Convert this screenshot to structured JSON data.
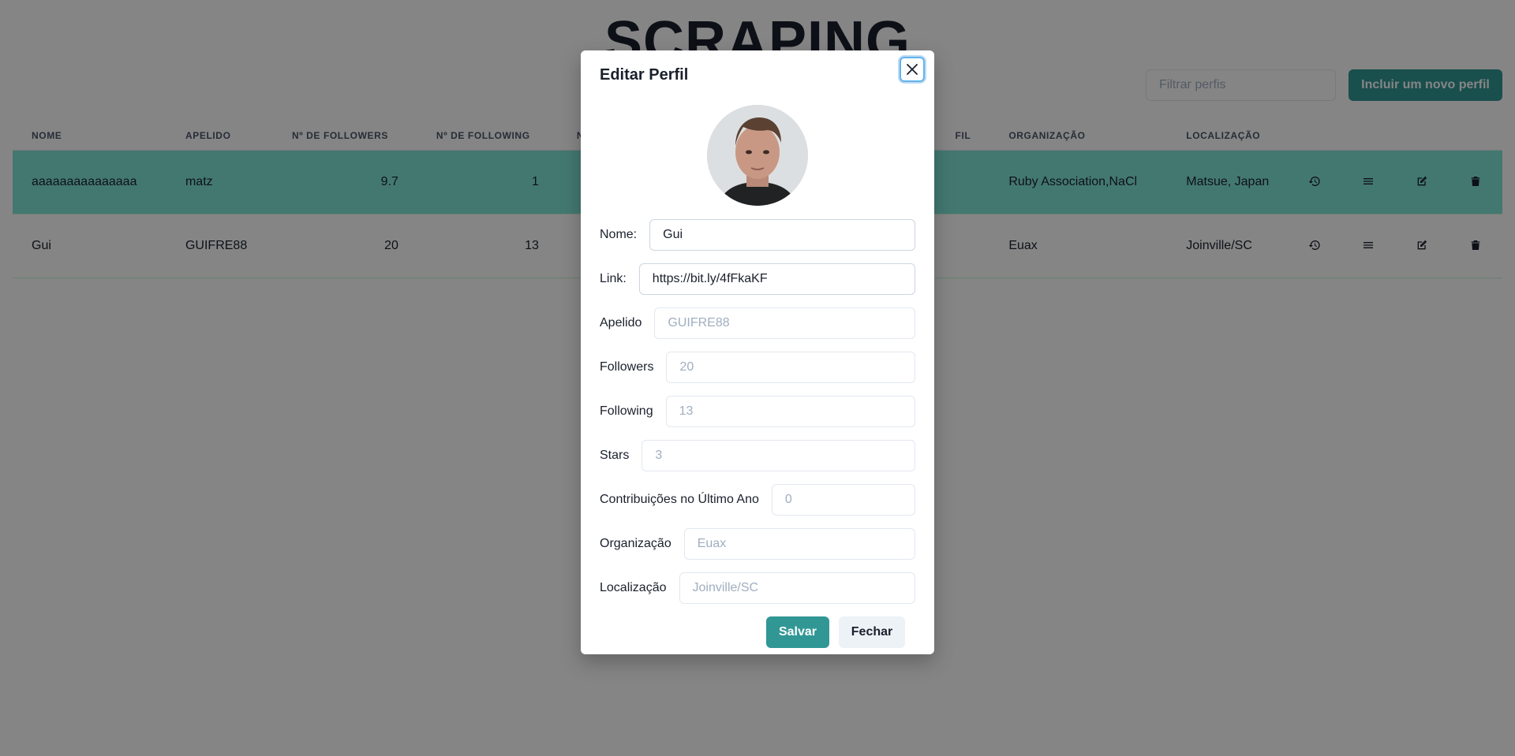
{
  "app": {
    "title": "SCRAPING"
  },
  "toolbar": {
    "filter_placeholder": "Filtrar perfis",
    "add_label": "Incluir um novo perfil"
  },
  "table": {
    "headers": [
      "NOME",
      "APELIDO",
      "Nº DE FOLLOWERS",
      "Nº DE FOLLOWING",
      "N",
      "FIL",
      "ORGANIZAÇÃO",
      "LOCALIZAÇÃO"
    ],
    "rows": [
      {
        "nome": "aaaaaaaaaaaaaaa",
        "apelido": "matz",
        "followers": "9.7",
        "following": "1",
        "organizacao": "Ruby Association,NaCl",
        "localizacao": "Matsue, Japan",
        "highlighted": true
      },
      {
        "nome": "Gui",
        "apelido": "GUIFRE88",
        "followers": "20",
        "following": "13",
        "organizacao": "Euax",
        "localizacao": "Joinville/SC",
        "highlighted": false
      }
    ],
    "row_actions": [
      "history-icon",
      "menu-icon",
      "edit-icon",
      "trash-icon"
    ]
  },
  "modal": {
    "title": "Editar Perfil",
    "fields": {
      "nome": {
        "label": "Nome:",
        "value": "Gui"
      },
      "link": {
        "label": "Link:",
        "value": "https://bit.ly/4fFkaKF"
      },
      "apelido": {
        "label": "Apelido",
        "placeholder": "GUIFRE88"
      },
      "followers": {
        "label": "Followers",
        "placeholder": "20"
      },
      "following": {
        "label": "Following",
        "placeholder": "13"
      },
      "stars": {
        "label": "Stars",
        "placeholder": "3"
      },
      "contribuicoes": {
        "label": "Contribuições no Último Ano",
        "placeholder": "0"
      },
      "organizacao": {
        "label": "Organização",
        "placeholder": "Euax"
      },
      "localizacao": {
        "label": "Localização",
        "placeholder": "Joinville/SC"
      }
    },
    "save_label": "Salvar",
    "close_label": "Fechar"
  },
  "colors": {
    "accent": "#319795",
    "row_highlight": "#81e6d9",
    "overlay": "rgba(0,0,0,0.48)"
  }
}
